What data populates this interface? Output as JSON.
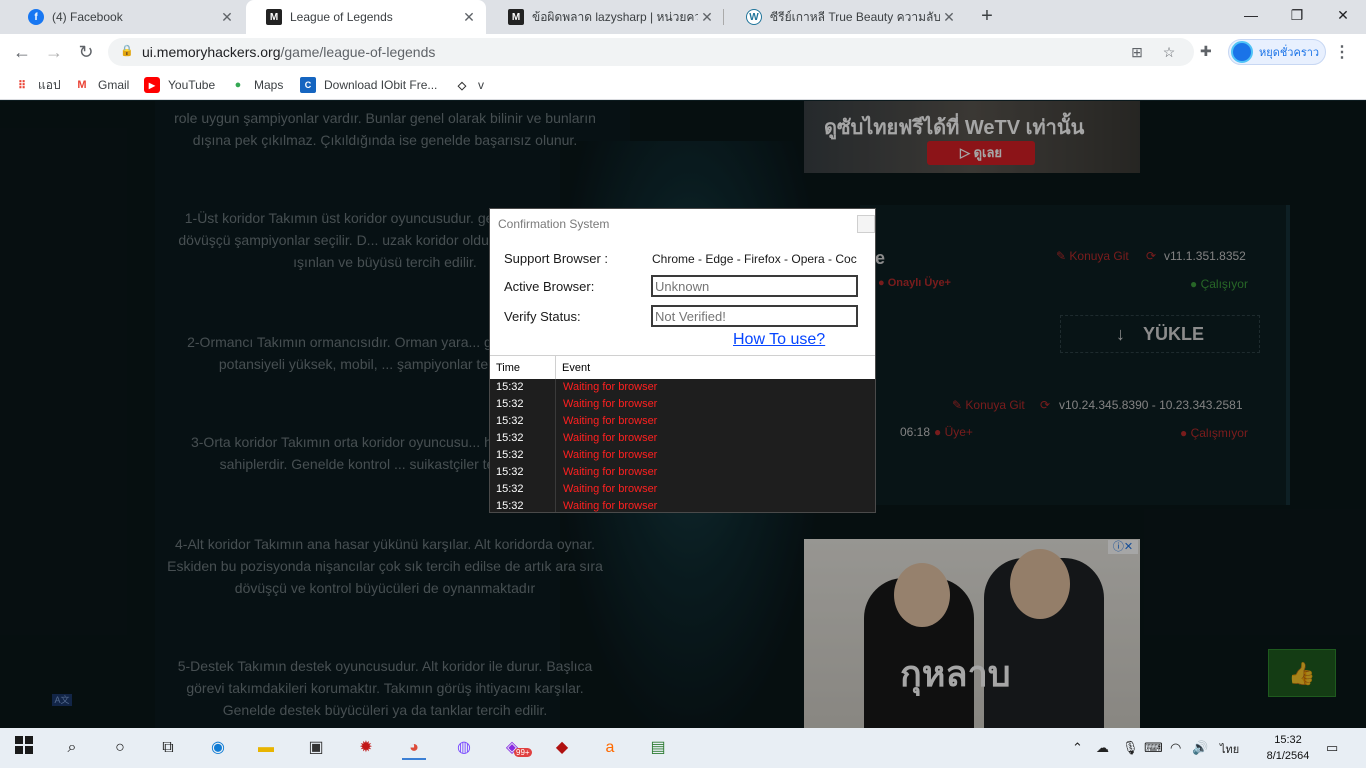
{
  "tabs": [
    {
      "title": "(4) Facebook",
      "icon": "facebook-icon"
    },
    {
      "title": "League of Legends",
      "icon": "memoryhackers-icon"
    },
    {
      "title": "ข้อผิดพลาด lazysharp | หน่วยความจำ",
      "icon": "memoryhackers-icon"
    },
    {
      "title": "ซีรีย์เกาหลี True Beauty ความลับของนางฟ้า",
      "icon": "wordpress-icon"
    }
  ],
  "address": {
    "host": "ui.memoryhackers.org",
    "path": "/game/league-of-legends"
  },
  "profile": {
    "label": "หยุดชั่วคราว"
  },
  "bookmarks": [
    {
      "label": "แอป"
    },
    {
      "label": "Gmail"
    },
    {
      "label": "YouTube"
    },
    {
      "label": "Maps"
    },
    {
      "label": "Download IObit Fre..."
    },
    {
      "label": "v"
    }
  ],
  "article": {
    "p0": "role uygun şampiyonlar vardır. Bunlar genel olarak bilinir ve bunların dışına pek çıkılmaz. Çıkıldığında ise genelde başarısız olunur.",
    "p1": "1-Üst koridor Takımın üst koridor oyuncusudur. genellikle tank ve dövüşçü şampiyonlar seçilir. D... uzak koridor olduğu için genellikle ışınlan ve büyüsü tercih edilir.",
    "p2": "2-Ormancı Takımın ormancısıdır. Orman yara... güçlenir. Baskın potansiyeli yüksek, mobil, ... şampiyonlar tercih edili...",
    "p3": "3-Orta koridor Takımın orta koridor oyuncusu... hasar yüklerine sahiplerdir. Genelde kontrol ... suikastçiler tercih edilir",
    "p4": "4-Alt koridor Takımın ana hasar yükünü karşılar. Alt koridorda oynar. Eskiden bu pozisyonda nişancılar çok sık tercih edilse de artık ara sıra dövüşçü ve kontrol büyücüleri de oynanmaktadır",
    "p5": "5-Destek Takımın destek oyuncusudur. Alt koridor ile durur. Başlıca görevi takımdakileri korumaktır. Takımın görüş ihtiyacını karşılar. Genelde destek büyücüleri ya da tanklar tercih edilir."
  },
  "ad_top": {
    "text": "ดูซับไทยฟรีได้ที่  WeTV เท่านั้น",
    "button": "▷ ดูเลย"
  },
  "ad_bottom": {
    "text": "กุหลาบ",
    "adchoice": "ⓘ✕"
  },
  "panel": {
    "title_suffix": "ie",
    "link1": "Konuya Git",
    "version1": "v11.1.351.8352",
    "badge1": "Onaylı Üye+",
    "status1": "Çalışıyor",
    "download": "YÜKLE",
    "link2": "Konuya Git",
    "version2": "v10.24.345.8390 - 10.23.343.2581",
    "time2": "06:18",
    "badge2": "Üye+",
    "status2": "Çalışmıyor"
  },
  "dialog": {
    "title": "Confirmation System",
    "support_label": "Support Browser :",
    "support_value": "Chrome - Edge - Firefox - Opera - Coc",
    "active_label": "Active Browser:",
    "active_placeholder": "Unknown",
    "verify_label": "Verify Status:",
    "verify_placeholder": "Not Verified!",
    "howto": "How To use?",
    "col_time": "Time",
    "col_event": "Event",
    "log": [
      {
        "time": "15:32",
        "event": "Waiting for browser"
      },
      {
        "time": "15:32",
        "event": "Waiting for browser"
      },
      {
        "time": "15:32",
        "event": "Waiting for browser"
      },
      {
        "time": "15:32",
        "event": "Waiting for browser"
      },
      {
        "time": "15:32",
        "event": "Waiting for browser"
      },
      {
        "time": "15:32",
        "event": "Waiting for browser"
      },
      {
        "time": "15:32",
        "event": "Waiting for browser"
      },
      {
        "time": "15:32",
        "event": "Waiting for browser"
      }
    ]
  },
  "taskbar": {
    "lang": "ไทย",
    "time": "15:32",
    "date": "8/1/2564",
    "notif_count": "99+",
    "translate_badge": "A文"
  },
  "colors": {
    "accent": "#1a73e8",
    "error": "#ff2020",
    "panel_red": "#b92c2c",
    "panel_green": "#3c9d3c"
  }
}
